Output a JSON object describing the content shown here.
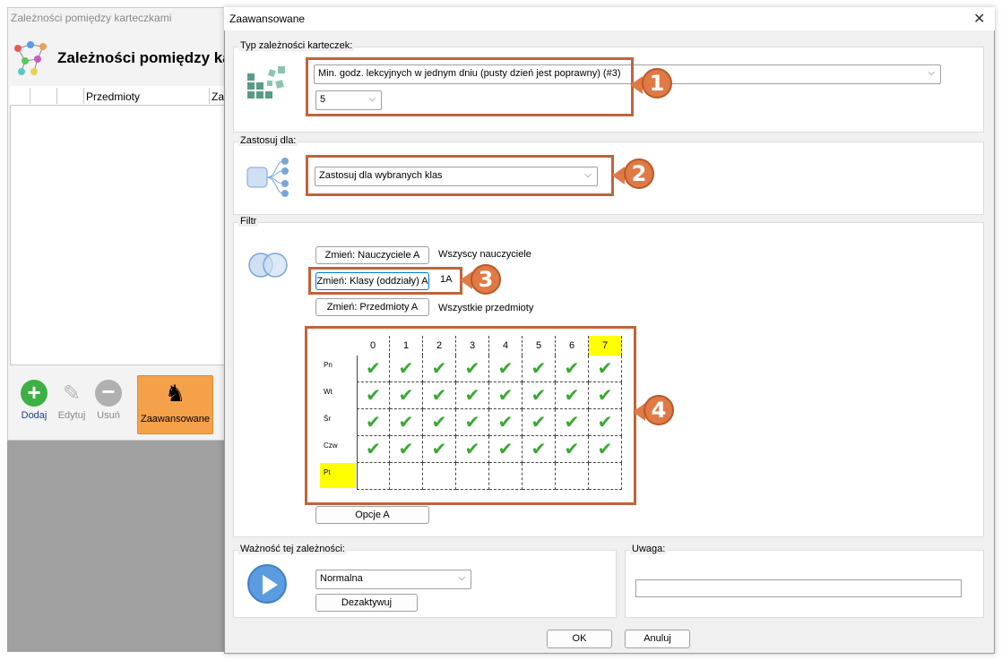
{
  "background_window": {
    "title": "Zależności pomiędzy karteczkami",
    "header": "Zależności pomiędzy ka",
    "columns": [
      "Przedmioty",
      "Za"
    ],
    "toolbar": {
      "add": "Dodaj",
      "edit": "Edytuj",
      "delete": "Usuń",
      "advanced": "Zaawansowane"
    }
  },
  "dialog": {
    "title": "Zaawansowane",
    "close_glyph": "✕",
    "type_group": {
      "label": "Typ zależności karteczek:",
      "type_value": "Min. godz. lekcyjnych w jednym dniu (pusty dzień jest poprawny) (#3)",
      "count_value": "5"
    },
    "apply_group": {
      "label": "Zastosuj dla:",
      "value": "Zastosuj dla wybranych klas"
    },
    "filter_group": {
      "label": "Filtr",
      "teachers_button": "Zmień: Nauczyciele A",
      "teachers_value": "Wszyscy nauczyciele",
      "classes_button": "Zmień: Klasy (oddziały) A",
      "classes_value": "1A",
      "subjects_button": "Zmień: Przedmioty A",
      "subjects_value": "Wszystkie przedmioty",
      "options_button": "Opcje A"
    },
    "grid": {
      "columns": [
        "0",
        "1",
        "2",
        "3",
        "4",
        "5",
        "6",
        "7"
      ],
      "rows": [
        "Pn",
        "Wt",
        "Śr",
        "Czw",
        "Pt"
      ],
      "highlighted_column": "7",
      "highlighted_row": "Pt",
      "checked": [
        [
          true,
          true,
          true,
          true,
          true,
          true,
          true,
          true
        ],
        [
          true,
          true,
          true,
          true,
          true,
          true,
          true,
          true
        ],
        [
          true,
          true,
          true,
          true,
          true,
          true,
          true,
          true
        ],
        [
          true,
          true,
          true,
          true,
          true,
          true,
          true,
          true
        ],
        [
          false,
          false,
          false,
          false,
          false,
          false,
          false,
          false
        ]
      ],
      "check_glyph": "✔",
      "highlight_color": "#ffff00"
    },
    "importance_group": {
      "label": "Ważność tej zależności:",
      "value": "Normalna",
      "deactivate_button": "Dezaktywuj"
    },
    "note_group": {
      "label": "Uwaga:",
      "value": ""
    },
    "ok_button": "OK",
    "cancel_button": "Anuluj"
  },
  "callouts": [
    "1",
    "2",
    "3",
    "4"
  ],
  "colors": {
    "callout": "#c0643c",
    "badge": "#e07a45",
    "check": "#3aa832",
    "advanced_button": "#f5a14a"
  }
}
